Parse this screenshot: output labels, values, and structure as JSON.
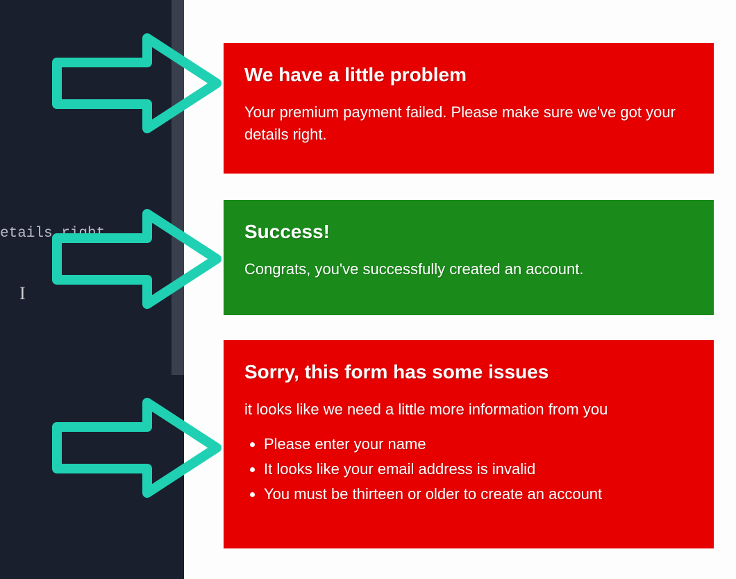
{
  "editor": {
    "snippet_line": "etails right."
  },
  "alerts": [
    {
      "title": "We have a little problem",
      "body": "Your premium payment failed. Please make sure we've got your details right."
    },
    {
      "title": "Success!",
      "body": "Congrats, you've successfully created an account."
    },
    {
      "title": "Sorry, this form has some issues",
      "body": "it looks like we need a little more information from you",
      "list": [
        "Please enter your name",
        "It looks like your email address is invalid",
        "You must be thirteen or older to create an account"
      ]
    }
  ],
  "colors": {
    "error_bg": "#e60000",
    "success_bg": "#1a8a1a",
    "arrow": "#1fd1b2",
    "editor_bg": "#1a1f2e"
  }
}
